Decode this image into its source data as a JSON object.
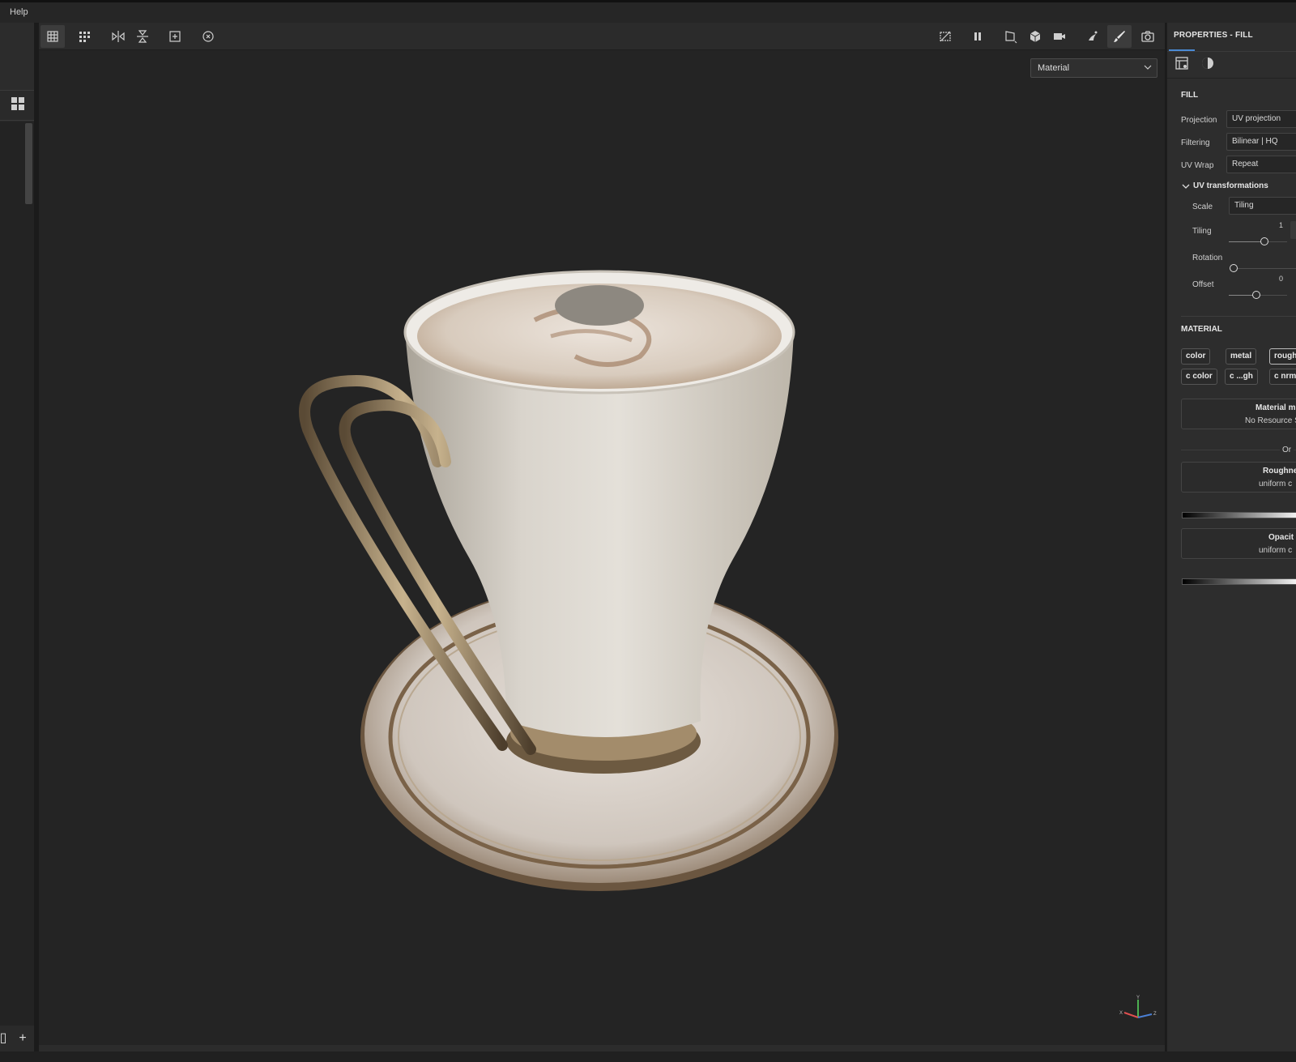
{
  "menubar": {
    "help_label": "Help"
  },
  "viewport": {
    "channel_select": "Material",
    "toolbar_left_icons": [
      "grid-select-icon",
      "grid-options-icon",
      "mirror-horizontal-icon",
      "mirror-vertical-icon",
      "fit-frame-icon",
      "reset-view-icon"
    ],
    "toolbar_right_icons": [
      "hide-icon",
      "pause-icon",
      "perspective-icon",
      "shading-icon",
      "camera-icon",
      "bake-icon",
      "paint-brush-icon",
      "screenshot-icon"
    ]
  },
  "properties": {
    "title": "PROPERTIES - FILL",
    "fill": {
      "section": "FILL",
      "projection_label": "Projection",
      "projection_value": "UV projection",
      "filtering_label": "Filtering",
      "filtering_value": "Bilinear | HQ",
      "uvwrap_label": "UV Wrap",
      "uvwrap_value": "Repeat",
      "uv_transform_label": "UV transformations",
      "scale_label": "Scale",
      "scale_value": "Tiling",
      "tiling_label": "Tiling",
      "tiling_value": "1",
      "rotation_label": "Rotation",
      "offset_label": "Offset",
      "offset_value": "0"
    },
    "material": {
      "section": "MATERIAL",
      "chips_row1": [
        "color",
        "metal",
        "rough"
      ],
      "chips_row2": [
        "c color",
        "c ...gh",
        "c nrm"
      ],
      "mode_title": "Material m",
      "mode_sub": "No Resource S",
      "or_label": "Or",
      "roughness_title": "Roughne",
      "roughness_sub": "uniform c",
      "opacity_title": "Opacit",
      "opacity_sub": "uniform c"
    }
  },
  "colors": {
    "accent": "#4a8ad4",
    "panel": "#2d2d2d",
    "viewport": "#242424"
  }
}
